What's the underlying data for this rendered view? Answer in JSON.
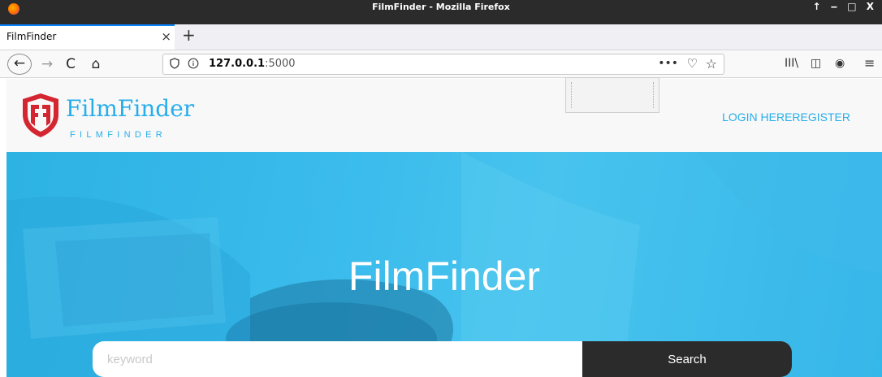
{
  "window": {
    "title": "FilmFinder - Mozilla Firefox",
    "controls": "↑ ‒ □ X"
  },
  "tabs": [
    {
      "label": "FilmFinder",
      "close": "×"
    }
  ],
  "new_tab": "+",
  "nav": {
    "back": "←",
    "forward": "→",
    "reload": "C",
    "home": "⌂",
    "url_host": "127.0.0.1",
    "url_port": ":5000",
    "more": "•••",
    "pocket": "♡",
    "star": "☆",
    "library": "III\\",
    "sidebar": "◫",
    "account": "◉",
    "menu": "≡"
  },
  "site": {
    "logo_text": "FilmFinder",
    "logo_sub": "FILMFINDER",
    "nav_login": "LOGIN HERE",
    "nav_register": "REGISTER",
    "brand_color": "#27aeea",
    "logo_color": "#d32630"
  },
  "hero": {
    "title": "FilmFinder",
    "search_placeholder": "keyword",
    "search_button": "Search"
  }
}
